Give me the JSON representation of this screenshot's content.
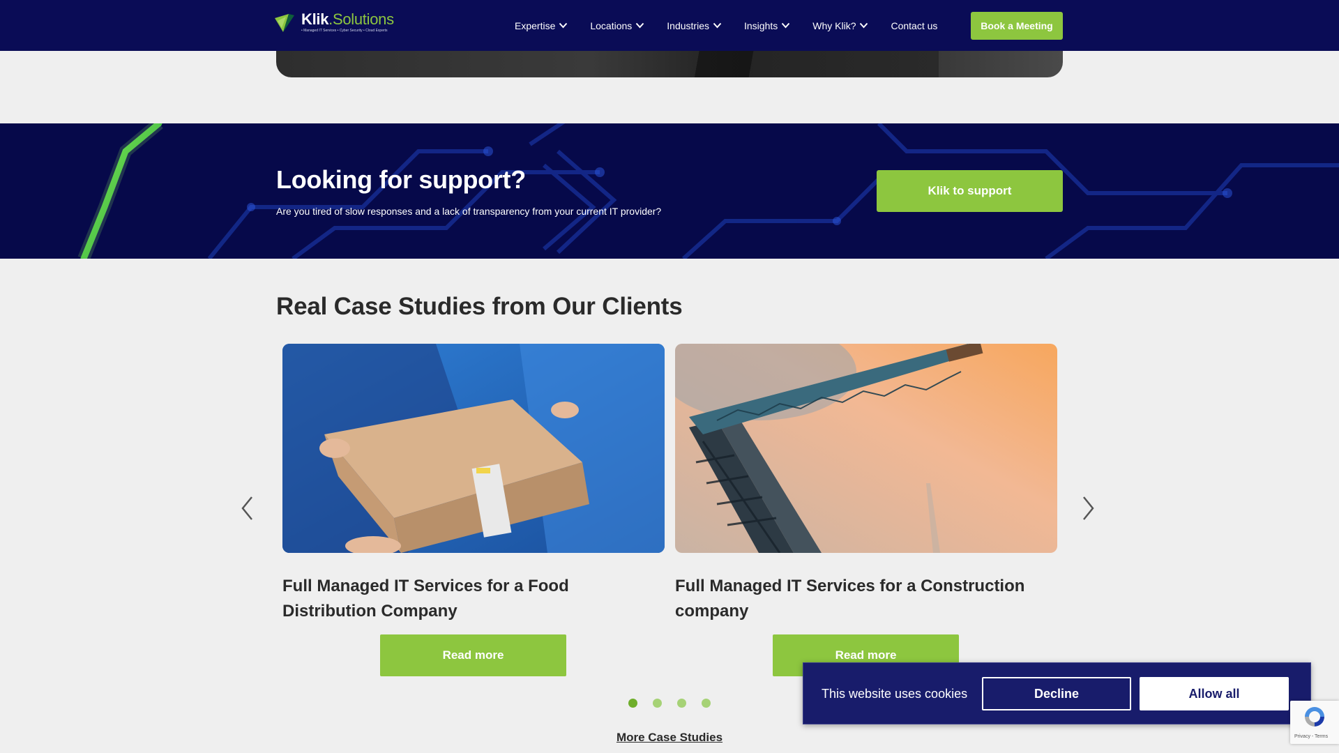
{
  "nav": {
    "brand": "Klik",
    "brand_suffix": ".Solutions",
    "tagline": "• Managed IT Services • Cyber Security • Cloud Experts",
    "items": [
      {
        "label": "Expertise",
        "has_dropdown": true
      },
      {
        "label": "Locations",
        "has_dropdown": true
      },
      {
        "label": "Industries",
        "has_dropdown": true
      },
      {
        "label": "Insights",
        "has_dropdown": true
      },
      {
        "label": "Why Klik?",
        "has_dropdown": true
      },
      {
        "label": "Contact us",
        "has_dropdown": false
      }
    ],
    "cta": "Book a Meeting"
  },
  "support": {
    "title": "Looking for support?",
    "subtitle": "Are you tired of slow responses and a lack of transparency from your current IT provider?",
    "button": "Klik to support"
  },
  "case_studies": {
    "heading": "Real Case Studies from Our Clients",
    "cards": [
      {
        "title": "Full Managed IT Services for a Food Distribution Company",
        "button": "Read more"
      },
      {
        "title": "Full Managed IT Services for a Construction company",
        "button": "Read more"
      }
    ],
    "pagination": {
      "count": 4,
      "active": 1
    },
    "more_link": "More Case Studies"
  },
  "cookie": {
    "text": "This website uses cookies",
    "decline": "Decline",
    "allow": "Allow all"
  },
  "recaptcha": {
    "legal": "Privacy - Terms"
  },
  "colors": {
    "navy": "#0a0c56",
    "green": "#8dc63f",
    "cookie_bg": "#181c6b",
    "page_bg": "#efefef"
  }
}
